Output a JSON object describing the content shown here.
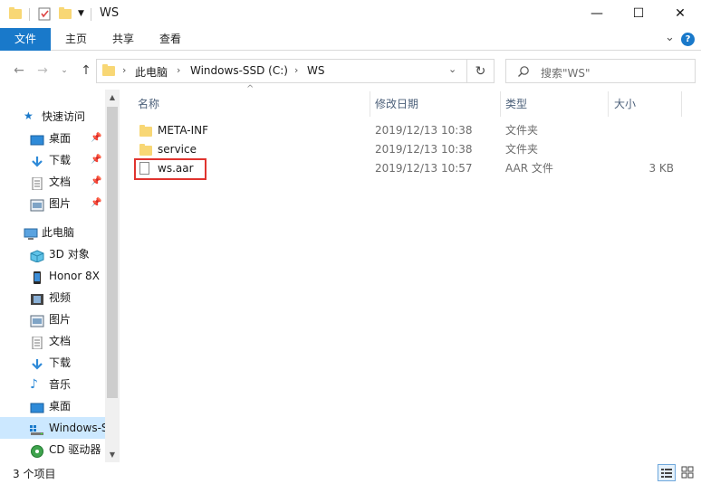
{
  "window": {
    "title": "WS",
    "minimize": "—",
    "maximize": "☐",
    "close": "✕"
  },
  "ribbon": {
    "tabs": [
      "文件",
      "主页",
      "共享",
      "查看"
    ],
    "expand_glyph": "⌄",
    "help_glyph": "?"
  },
  "address": {
    "crumbs": [
      "此电脑",
      "Windows-SSD (C:)",
      "WS"
    ],
    "search_placeholder": "搜索\"WS\""
  },
  "nav": {
    "items": [
      {
        "label": "快速访问",
        "icon": "star-icon",
        "pinned": false
      },
      {
        "label": "桌面",
        "icon": "desktop-icon",
        "pinned": true
      },
      {
        "label": "下载",
        "icon": "download-icon",
        "pinned": true
      },
      {
        "label": "文档",
        "icon": "document-icon",
        "pinned": true
      },
      {
        "label": "图片",
        "icon": "pictures-icon",
        "pinned": true
      },
      {
        "label": "此电脑",
        "icon": "computer-icon",
        "pinned": false
      },
      {
        "label": "3D 对象",
        "icon": "cube-icon",
        "pinned": false
      },
      {
        "label": "Honor 8X",
        "icon": "phone-icon",
        "pinned": false
      },
      {
        "label": "视频",
        "icon": "video-icon",
        "pinned": false
      },
      {
        "label": "图片",
        "icon": "pictures-icon",
        "pinned": false
      },
      {
        "label": "文档",
        "icon": "document-icon",
        "pinned": false
      },
      {
        "label": "下载",
        "icon": "download-icon",
        "pinned": false
      },
      {
        "label": "音乐",
        "icon": "music-icon",
        "pinned": false
      },
      {
        "label": "桌面",
        "icon": "desktop-icon",
        "pinned": false
      },
      {
        "label": "Windows-S",
        "icon": "drive-icon",
        "pinned": false
      },
      {
        "label": "CD 驱动器",
        "icon": "cd-drive-icon",
        "pinned": false
      }
    ]
  },
  "columns": {
    "name": "名称",
    "modified": "修改日期",
    "type": "类型",
    "size": "大小"
  },
  "files": [
    {
      "name": "META-INF",
      "modified": "2019/12/13 10:38",
      "type": "文件夹",
      "size": "",
      "kind": "folder"
    },
    {
      "name": "service",
      "modified": "2019/12/13 10:38",
      "type": "文件夹",
      "size": "",
      "kind": "folder"
    },
    {
      "name": "ws.aar",
      "modified": "2019/12/13 10:57",
      "type": "AAR 文件",
      "size": "3 KB",
      "kind": "file"
    }
  ],
  "status": {
    "item_count": "3 个项目"
  },
  "colors": {
    "accent": "#1979ca",
    "selection": "#cce8ff",
    "folder": "#f8d775",
    "highlight_border": "#e0342f"
  }
}
